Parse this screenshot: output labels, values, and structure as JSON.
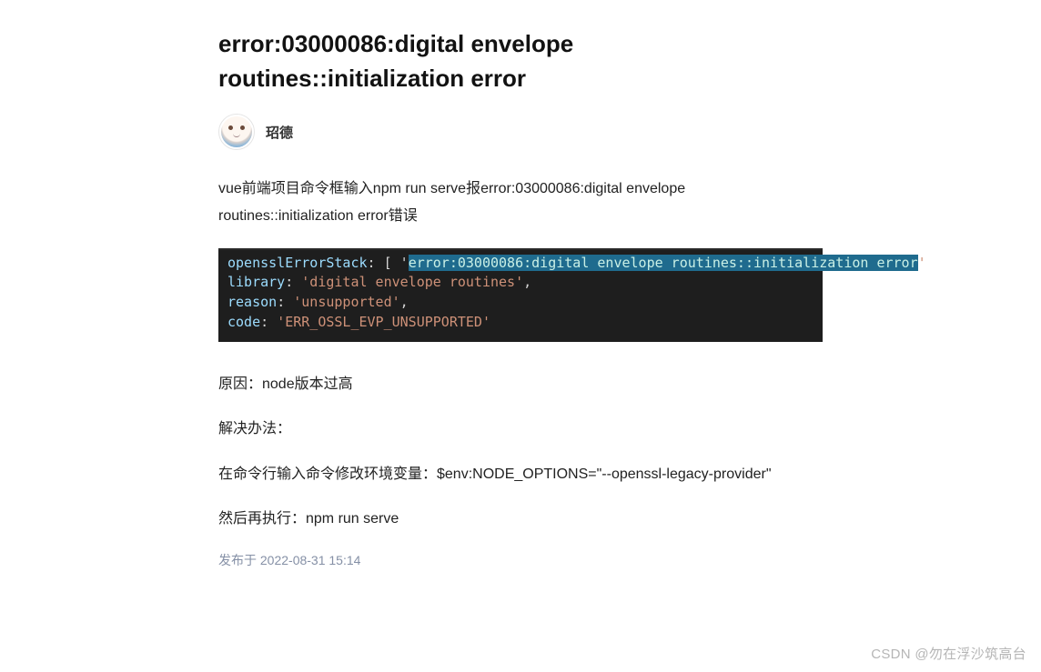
{
  "article": {
    "title": "error:03000086:digital envelope routines::initialization error",
    "author": "玿德",
    "intro": "vue前端项目命令框输入npm run serve报error:03000086:digital envelope routines::initialization error错误",
    "code": {
      "line1_key": "opensslErrorStack",
      "line1_prefix": ": [ '",
      "line1_selected": "error:03000086:digital envelope routines::initialization error",
      "line1_suffix": "'",
      "line2_key": "library",
      "line2_prefix": ": ",
      "line2_val": "'digital envelope routines'",
      "line2_comma": ",",
      "line3_key": "reason",
      "line3_prefix": ": ",
      "line3_val": "'unsupported'",
      "line3_comma": ",",
      "line4_key": "code",
      "line4_prefix": ": ",
      "line4_val": "'ERR_OSSL_EVP_UNSUPPORTED'"
    },
    "cause": "原因：node版本过高",
    "solution_label": "解决办法：",
    "solution_cmd": "在命令行输入命令修改环境变量：$env:NODE_OPTIONS=\"--openssl-legacy-provider\"",
    "then_run": "然后再执行：npm run serve",
    "publish": "发布于 2022-08-31 15:14"
  },
  "watermark": "CSDN @勿在浮沙筑高台"
}
